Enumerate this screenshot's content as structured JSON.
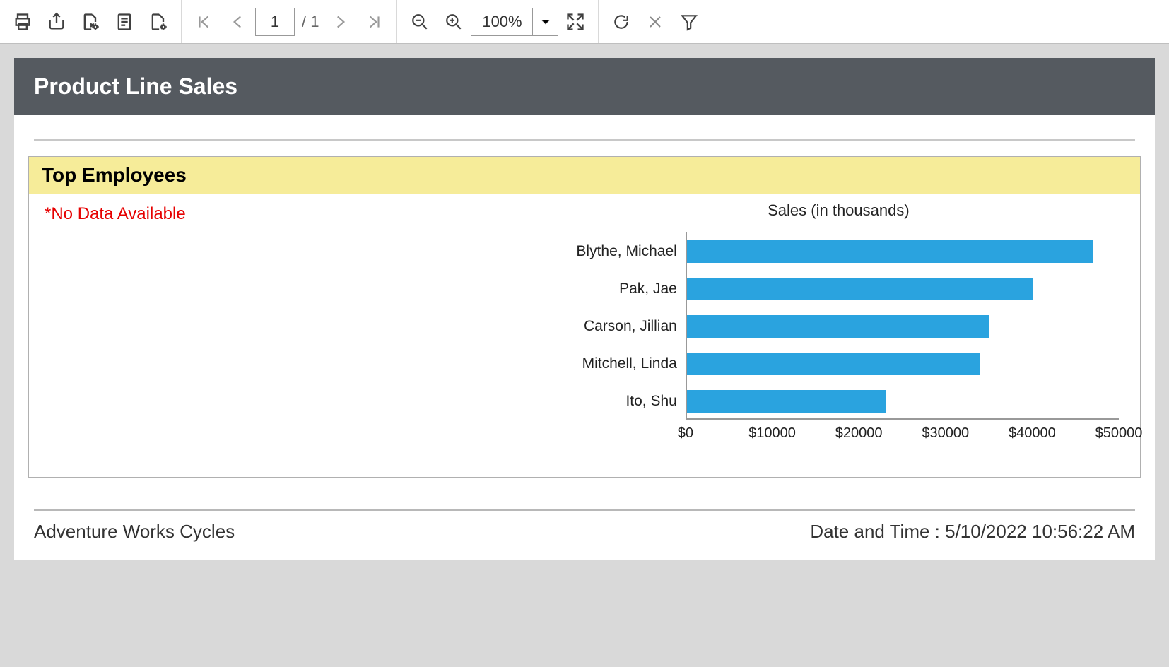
{
  "toolbar": {
    "page_current": "1",
    "page_total": "/ 1",
    "zoom": "100%"
  },
  "report": {
    "title": "Product Line Sales",
    "section_title": "Top Employees",
    "no_data_message": "*No Data Available",
    "footer_left": "Adventure Works Cycles",
    "footer_right": "Date and Time : 5/10/2022 10:56:22 AM"
  },
  "chart_data": {
    "type": "bar",
    "orientation": "horizontal",
    "title": "Sales (in thousands)",
    "xlabel": "",
    "ylabel": "",
    "xlim": [
      0,
      50000
    ],
    "xticks": [
      0,
      10000,
      20000,
      30000,
      40000,
      50000
    ],
    "xtick_labels": [
      "$0",
      "$10000",
      "$20000",
      "$30000",
      "$40000",
      "$50000"
    ],
    "categories": [
      "Blythe, Michael",
      "Pak, Jae",
      "Carson, Jillian",
      "Mitchell, Linda",
      "Ito, Shu"
    ],
    "values": [
      47000,
      40000,
      35000,
      34000,
      23000
    ],
    "bar_color": "#2aa3df"
  }
}
